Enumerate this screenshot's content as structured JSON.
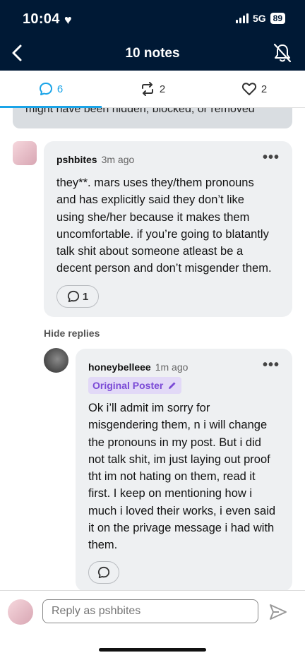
{
  "status": {
    "time": "10:04",
    "network": "5G",
    "battery": "89"
  },
  "nav": {
    "title": "10 notes"
  },
  "tabs": [
    {
      "name": "replies",
      "count": "6"
    },
    {
      "name": "reblogs",
      "count": "2"
    },
    {
      "name": "likes",
      "count": "2"
    }
  ],
  "previous_note": {
    "text": "might have been hidden, blocked, or removed"
  },
  "comment1": {
    "username": "pshbites",
    "time": "3m ago",
    "lines": [
      "they**. mars uses they/them pronouns",
      "and has explicitly said they don’t like",
      "using she/her because it makes them",
      "uncomfortable. if you’re going to blatantly",
      "talk shit about someone atleast be a",
      "decent person and don’t misgender them."
    ],
    "reply_count": "1"
  },
  "hide_replies": "Hide replies",
  "comment2": {
    "username": "honeybelleee",
    "time": "1m ago",
    "badge": "Original Poster",
    "lines": [
      "Ok i’ll admit im sorry for",
      "misgendering them, n i will change",
      "the pronouns in my post. But i did",
      "not talk shit, im just laying out proof",
      "tht im not hating on them, read it",
      "first. I keep on mentioning how i",
      "much i loved their works, i even said",
      "it on the privage message i had with",
      "them."
    ]
  },
  "composer": {
    "placeholder": "Reply as pshbites"
  },
  "colors": {
    "header": "#001935",
    "accent": "#1aa4e8",
    "op_badge": "#7b4ad6"
  },
  "icons": [
    "back-chevron-icon",
    "bell-off-icon",
    "comment-icon",
    "reblog-icon",
    "heart-icon",
    "more-icon",
    "pencil-icon",
    "send-icon"
  ]
}
